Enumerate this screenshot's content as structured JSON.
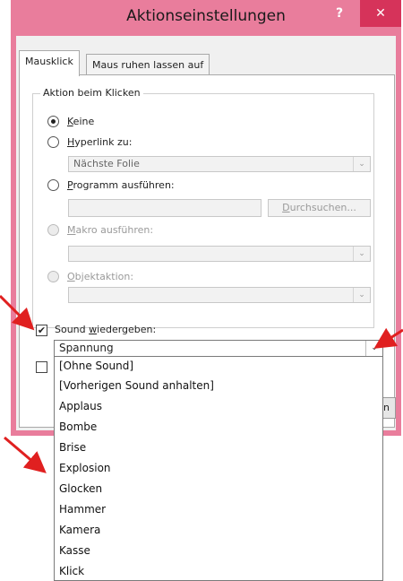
{
  "window": {
    "title": "Aktionseinstellungen",
    "help_label": "?",
    "close_label": "✕"
  },
  "tabs": [
    {
      "label": "Mausklick",
      "active": true
    },
    {
      "label": "Maus ruhen lassen auf",
      "active": false
    }
  ],
  "group": {
    "legend": "Aktion beim Klicken",
    "options": [
      {
        "label_key": "K",
        "label_rest": "eine",
        "checked": true,
        "enabled": true
      },
      {
        "label_key": "H",
        "label_rest": "yperlink zu:",
        "checked": false,
        "enabled": true
      },
      {
        "label_key": "P",
        "label_rest": "rogramm ausführen:",
        "checked": false,
        "enabled": true
      },
      {
        "label_key": "M",
        "label_rest": "akro ausführen:",
        "checked": false,
        "enabled": false
      },
      {
        "label_key": "O",
        "label_rest": "bjektaktion:",
        "checked": false,
        "enabled": false
      }
    ],
    "hyperlink_value": "Nächste Folie",
    "program_value": "",
    "browse_button_key": "D",
    "browse_button_rest": "urchsuchen...",
    "macro_value": "",
    "object_action_value": ""
  },
  "sound": {
    "checkbox_checked": true,
    "label_before": "Sound ",
    "label_key": "w",
    "label_after": "iedergeben:",
    "selected": "Spannung",
    "options": [
      "[Ohne Sound]",
      "[Vorherigen Sound anhalten]",
      "Applaus",
      "Bombe",
      "Brise",
      "Explosion",
      "Glocken",
      "Hammer",
      "Kamera",
      "Kasse",
      "Klick"
    ]
  },
  "second_checkbox_checked": false,
  "partial_button_label": "n",
  "colors": {
    "title_bar": "#e97d9c",
    "close_button": "#d6335a",
    "annotation_arrow": "#e02020"
  }
}
